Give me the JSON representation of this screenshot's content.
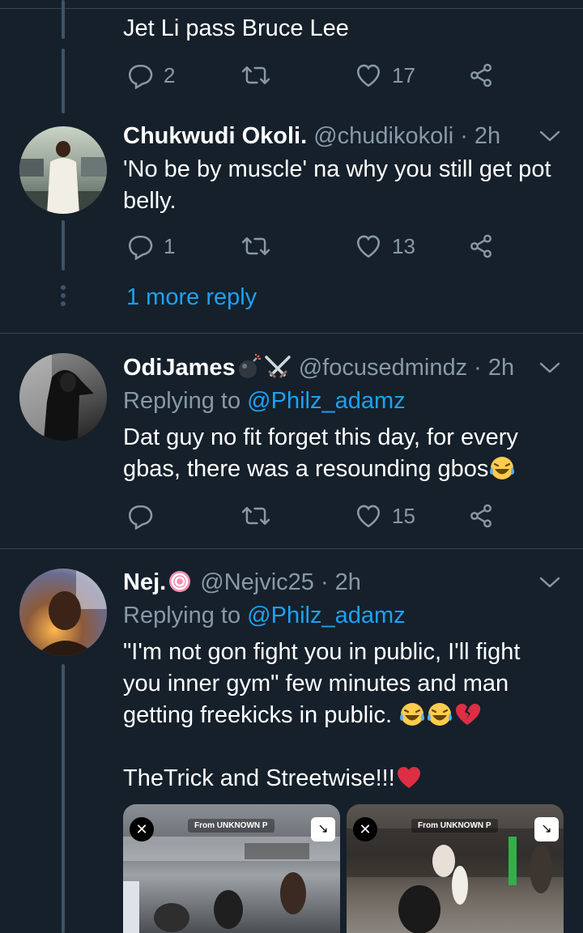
{
  "colors": {
    "background": "#15202b",
    "text_primary": "#ffffff",
    "text_secondary": "#8899a6",
    "link": "#1da1f2",
    "thread_line": "#3d5466",
    "separator": "#38444d",
    "heart_emoji": "#e0245e"
  },
  "top_tweet": {
    "text": "Jet Li pass Bruce Lee",
    "actions": {
      "reply_count": "2",
      "retweet_count": "",
      "like_count": "17"
    }
  },
  "tweets": [
    {
      "name": "Chukwudi Okoli.",
      "handle": "@chudikokoli",
      "time": "· 2h",
      "lines": [
        "'No be by muscle' na why you still get pot",
        "belly."
      ],
      "actions": {
        "reply_count": "1",
        "retweet_count": "",
        "like_count": "13"
      },
      "more_replies": "1 more reply"
    },
    {
      "name": "OdiJames",
      "handle": "@focusedmindz",
      "time": "· 2h",
      "replying_prefix": "Replying to",
      "replying_to": "@Philz_adamz",
      "lines": [
        "Dat guy no fit forget this day, for every",
        "gbas, there was a resounding gbos"
      ],
      "actions": {
        "reply_count": "",
        "retweet_count": "",
        "like_count": "15"
      }
    },
    {
      "name": "Nej.",
      "handle": "@Nejvic25",
      "time": "· 2h",
      "replying_prefix": "Replying to",
      "replying_to": "@Philz_adamz",
      "lines": [
        "\"I'm not gon fight you in public, I'll fight",
        "you inner gym\" few minutes and man",
        "getting freekicks in public."
      ],
      "line_extra": "TheTrick and Streetwise!!!",
      "media": [
        {
          "caption": "From UNKNOWN P"
        },
        {
          "caption": "From UNKNOWN P"
        }
      ]
    }
  ],
  "icons": [
    "reply-icon",
    "retweet-icon",
    "like-icon",
    "share-icon",
    "chevron-down-icon",
    "bomb-icon",
    "crossed-swords-icon",
    "lollipop-icon",
    "laughing-emoji-icon",
    "broken-heart-icon",
    "heart-icon"
  ]
}
